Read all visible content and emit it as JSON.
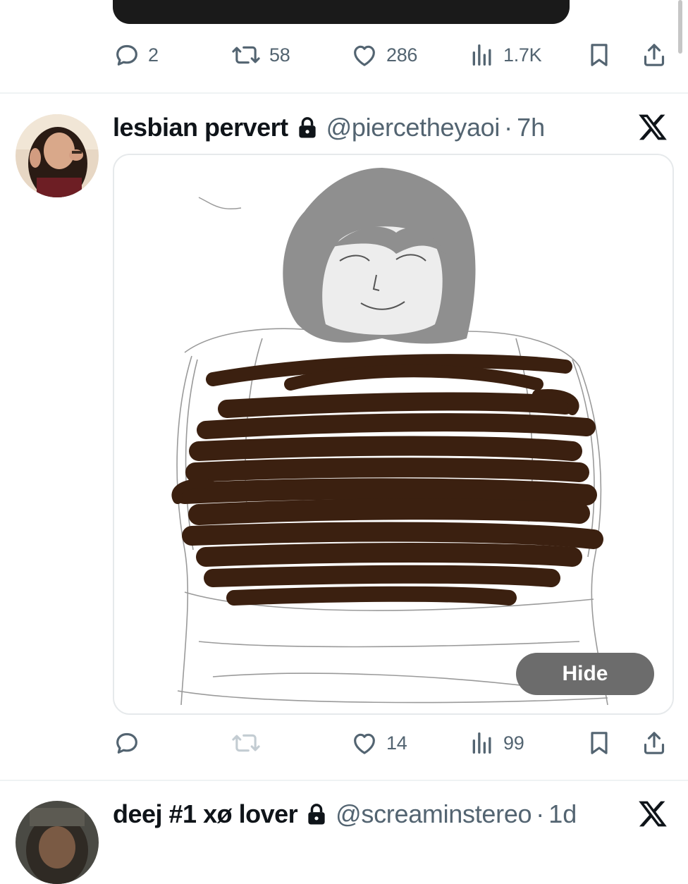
{
  "previous_tweet": {
    "actions": {
      "replies": "2",
      "retweets": "58",
      "likes": "286",
      "views": "1.7K"
    }
  },
  "tweet": {
    "display_name": "lesbian pervert",
    "handle": "@piercetheyaoi",
    "separator": "·",
    "time": "7h",
    "hide_label": "Hide",
    "actions": {
      "replies": "",
      "retweets": "",
      "likes": "14",
      "views": "99"
    }
  },
  "next_tweet": {
    "display_name": "deej #1 xø lover",
    "handle": "@screaminstereo",
    "separator": "·",
    "time": "1d"
  },
  "icons": {
    "reply": "reply-icon",
    "retweet": "retweet-icon",
    "like": "heart-icon",
    "views": "views-icon",
    "bookmark": "bookmark-icon",
    "share": "share-icon",
    "lock": "lock-icon",
    "brand": "x-logo-icon"
  },
  "colors": {
    "text_primary": "#0f1419",
    "text_secondary": "#536471",
    "retweet_disabled": "#c3ccd2",
    "hide_button": "#6c6c6c",
    "divider": "#eff3f4",
    "scribble": "#3b2010"
  }
}
